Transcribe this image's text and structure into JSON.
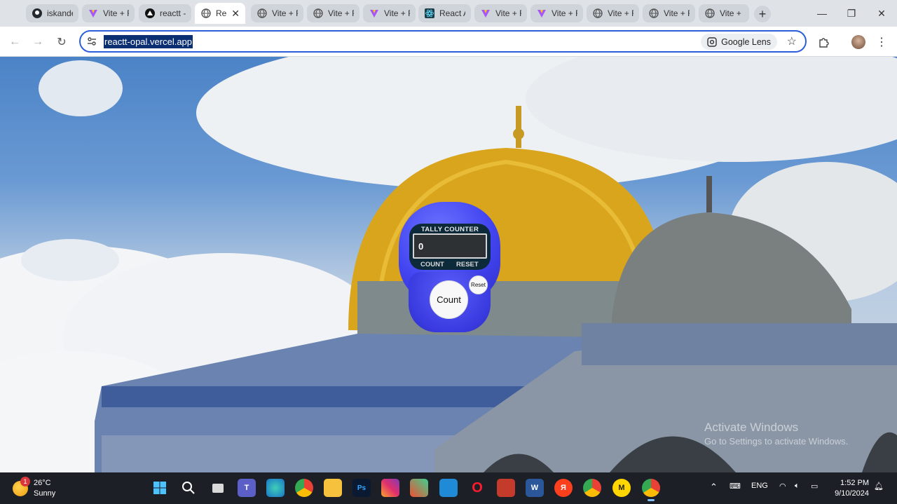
{
  "browser": {
    "tabs": [
      {
        "title": "iskande",
        "icon": "github-icon"
      },
      {
        "title": "Vite + R",
        "icon": "vite-icon"
      },
      {
        "title": "reactt -",
        "icon": "vercel-icon"
      },
      {
        "title": "Re",
        "icon": "globe-icon",
        "active": true
      },
      {
        "title": "Vite + R",
        "icon": "globe-icon"
      },
      {
        "title": "Vite + R",
        "icon": "globe-icon"
      },
      {
        "title": "Vite + R",
        "icon": "vite-icon"
      },
      {
        "title": "React A",
        "icon": "react-icon"
      },
      {
        "title": "Vite + R",
        "icon": "vite-icon"
      },
      {
        "title": "Vite + R",
        "icon": "vite-icon"
      },
      {
        "title": "Vite + R",
        "icon": "globe-icon"
      },
      {
        "title": "Vite + R",
        "icon": "globe-icon"
      },
      {
        "title": "Vite + R",
        "icon": "globe-icon"
      }
    ],
    "url": "reactt-opal.vercel.app",
    "lens_label": "Google Lens"
  },
  "app": {
    "tally_title": "TALLY COUNTER",
    "display_value": "0",
    "count_label": "COUNT",
    "reset_label": "RESET",
    "count_button": "Count",
    "reset_button": "Reset"
  },
  "watermark": {
    "title": "Activate Windows",
    "subtitle": "Go to Settings to activate Windows."
  },
  "taskbar": {
    "weather_temp": "26°C",
    "weather_cond": "Sunny",
    "weather_badge": "1",
    "lang": "ENG",
    "time": "1:52 PM",
    "date": "9/10/2024"
  }
}
